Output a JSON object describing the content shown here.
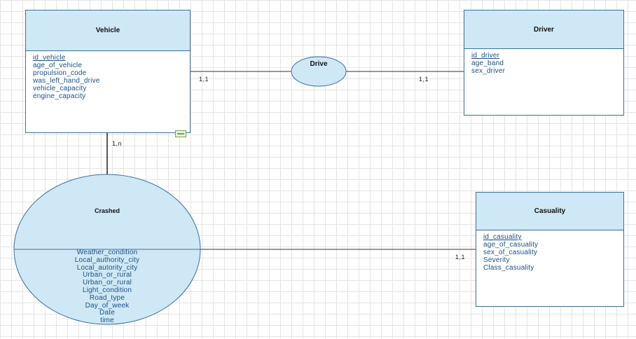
{
  "entities": {
    "vehicle": {
      "title": "Vehicle",
      "attributes": [
        {
          "name": "id_vehicle",
          "key": true
        },
        {
          "name": "age_of_vehicle",
          "key": false
        },
        {
          "name": "propulsion_code",
          "key": false
        },
        {
          "name": "was_left_hand_drive",
          "key": false
        },
        {
          "name": "vehicle_capacity",
          "key": false
        },
        {
          "name": "engine_capacity",
          "key": false
        }
      ]
    },
    "driver": {
      "title": "Driver",
      "attributes": [
        {
          "name": "id_driver",
          "key": true
        },
        {
          "name": "age_band",
          "key": false
        },
        {
          "name": "sex_driver",
          "key": false
        }
      ]
    },
    "casuality": {
      "title": "Casuality",
      "attributes": [
        {
          "name": "id_casuality",
          "key": true
        },
        {
          "name": "age_of_casuality",
          "key": false
        },
        {
          "name": "sex_of_casuality",
          "key": false
        },
        {
          "name": "Severity",
          "key": false
        },
        {
          "name": "Class_casuality",
          "key": false
        }
      ]
    }
  },
  "relationships": {
    "drive": {
      "label": "Drive",
      "card_vehicle": "1,1",
      "card_driver": "1,1"
    },
    "crashed": {
      "label": "Crashed",
      "card_vehicle": "1,n",
      "card_casuality": "1,1",
      "attributes": [
        "Weather_condition",
        "Local_authority_city",
        "Local_autority_city",
        "Urban_or_rural",
        "Urban_or_rural",
        "Light_condition",
        "Road_type",
        "Day_of_week",
        "Date",
        "time"
      ]
    }
  },
  "colors": {
    "header_fill": "#cfe8f5",
    "border": "#3b6f9a",
    "attribute_text": "#1a4f86",
    "link": "#111111"
  },
  "icons": {
    "vehicle_corner": "collapse-toggle-icon"
  }
}
